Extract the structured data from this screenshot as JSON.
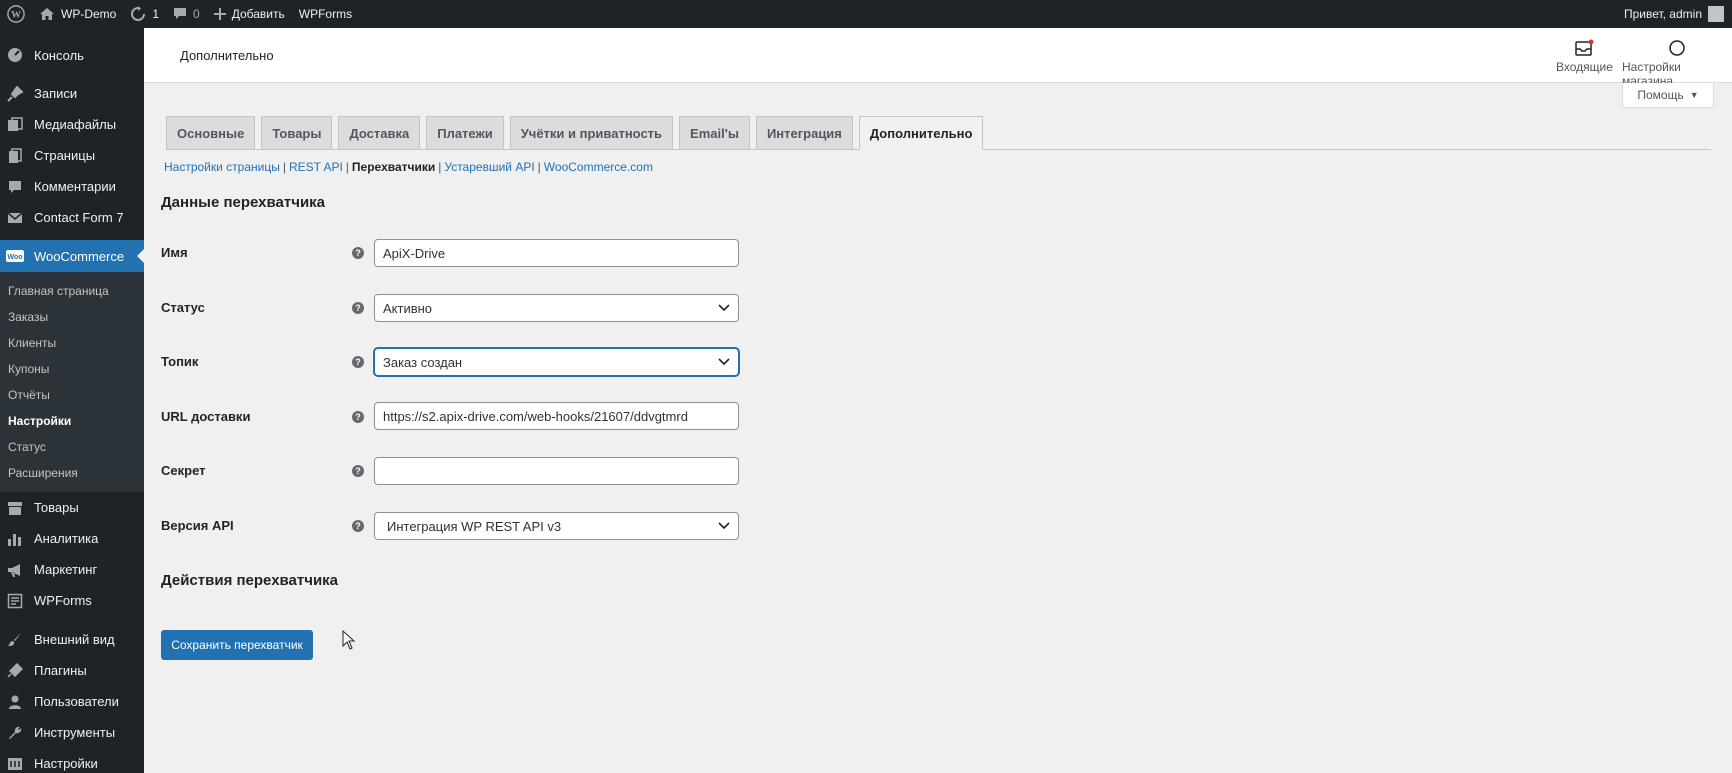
{
  "adminbar": {
    "site_name": "WP-Demo",
    "updates_count": "1",
    "comments_count": "0",
    "add_new_label": "Добавить",
    "wpforms_label": "WPForms",
    "greeting": "Привет, admin"
  },
  "sidebar": {
    "items_top": [
      {
        "label": "Консоль",
        "icon": "dashboard-icon"
      },
      {
        "label": "Записи",
        "icon": "pin-icon"
      },
      {
        "label": "Медиафайлы",
        "icon": "media-icon"
      },
      {
        "label": "Страницы",
        "icon": "pages-icon"
      },
      {
        "label": "Комментарии",
        "icon": "comments-icon"
      },
      {
        "label": "Contact Form 7",
        "icon": "mail-icon"
      }
    ],
    "woocommerce_label": "WooCommerce",
    "submenu": [
      {
        "label": "Главная страница"
      },
      {
        "label": "Заказы"
      },
      {
        "label": "Клиенты"
      },
      {
        "label": "Купоны"
      },
      {
        "label": "Отчёты"
      },
      {
        "label": "Настройки"
      },
      {
        "label": "Статус"
      },
      {
        "label": "Расширения"
      }
    ],
    "items_bottom": [
      {
        "label": "Товары",
        "icon": "archive-icon"
      },
      {
        "label": "Аналитика",
        "icon": "chart-icon"
      },
      {
        "label": "Маркетинг",
        "icon": "megaphone-icon"
      },
      {
        "label": "WPForms",
        "icon": "form-icon"
      },
      {
        "label": "Внешний вид",
        "icon": "brush-icon"
      },
      {
        "label": "Плагины",
        "icon": "plugin-icon"
      },
      {
        "label": "Пользователи",
        "icon": "user-icon"
      },
      {
        "label": "Инструменты",
        "icon": "wrench-icon"
      },
      {
        "label": "Настройки",
        "icon": "settings-icon"
      }
    ]
  },
  "header": {
    "title": "Дополнительно",
    "inbox_label": "Входящие",
    "store_settings_label": "Настройки магазина"
  },
  "help_label": "Помощь",
  "tabs": [
    {
      "label": "Основные"
    },
    {
      "label": "Товары"
    },
    {
      "label": "Доставка"
    },
    {
      "label": "Платежи"
    },
    {
      "label": "Учётки и приватность"
    },
    {
      "label": "Email'ы"
    },
    {
      "label": "Интеграция"
    },
    {
      "label": "Дополнительно"
    }
  ],
  "subsub": {
    "page_settings": "Настройки страницы",
    "rest_api": "REST API",
    "webhooks": "Перехватчики",
    "legacy_api": "Устаревший API",
    "woocommerce_com": "WooCommerce.com"
  },
  "webhook_data": {
    "heading": "Данные перехватчика",
    "name_label": "Имя",
    "name_value": "ApiX-Drive",
    "status_label": "Статус",
    "status_value": "Активно",
    "topic_label": "Топик",
    "topic_value": "Заказ создан",
    "delivery_url_label": "URL доставки",
    "delivery_url_value": "https://s2.apix-drive.com/web-hooks/21607/ddvgtmrd",
    "secret_label": "Секрет",
    "secret_value": "",
    "api_version_label": "Версия API",
    "api_version_value": "Интеграция WP REST API v3"
  },
  "webhook_actions": {
    "heading": "Действия перехватчика",
    "save_button": "Сохранить перехватчик"
  },
  "colors": {
    "admin_dark": "#1d2327",
    "accent_blue": "#2271b1",
    "background": "#f0f0f1"
  }
}
